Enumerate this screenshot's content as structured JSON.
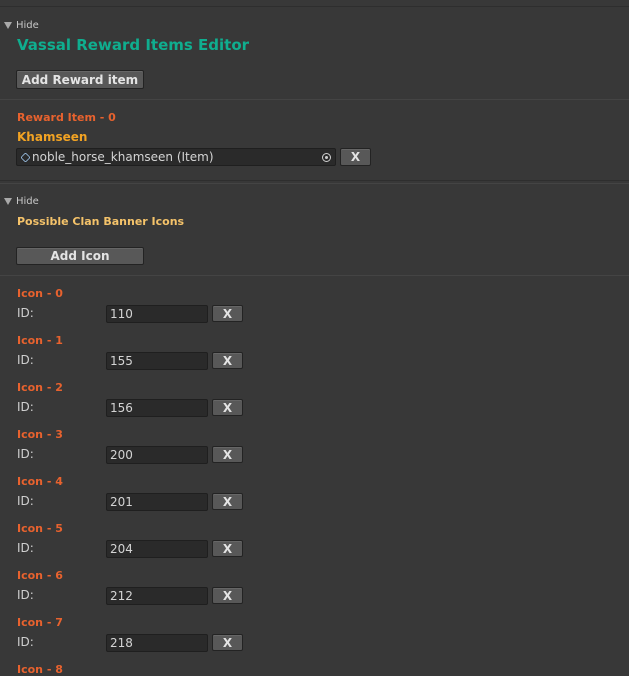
{
  "section1": {
    "foldout_label": "Hide",
    "title": "Vassal Reward Items Editor",
    "add_button": "Add Reward item",
    "item_header": "Reward Item - 0",
    "item_name": "Khamseen",
    "item_field_value": "noble_horse_khamseen (Item)",
    "remove_button": "X"
  },
  "section2": {
    "foldout_label": "Hide",
    "title": "Possible Clan Banner Icons",
    "add_button": "Add Icon",
    "id_label": "ID:",
    "remove_button": "X",
    "icons": [
      {
        "header": "Icon - 0",
        "id": "110"
      },
      {
        "header": "Icon - 1",
        "id": "155"
      },
      {
        "header": "Icon - 2",
        "id": "156"
      },
      {
        "header": "Icon - 3",
        "id": "200"
      },
      {
        "header": "Icon - 4",
        "id": "201"
      },
      {
        "header": "Icon - 5",
        "id": "204"
      },
      {
        "header": "Icon - 6",
        "id": "212"
      },
      {
        "header": "Icon - 7",
        "id": "218"
      },
      {
        "header": "Icon - 8",
        "id": ""
      }
    ]
  },
  "colors": {
    "background": "#383838",
    "title_teal": "#0fae8f",
    "header_red": "#e8622e",
    "name_orange": "#f2a323",
    "banner_yellow": "#f5c36a"
  },
  "icons": {
    "foldout": "triangle-down-icon",
    "object": "item-object-icon",
    "picker": "object-picker-icon"
  }
}
